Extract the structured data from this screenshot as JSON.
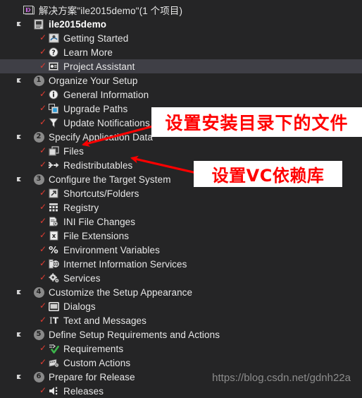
{
  "window": {
    "background_color": "#252526",
    "selection_color": "#3f3f46",
    "text_color": "#e8e8e8",
    "check_color": "#e03c31"
  },
  "solution": {
    "icon": "visual-studio-solution-icon",
    "label": "解决方案\"ile2015demo\"(1 个项目)"
  },
  "project": {
    "icon": "installshield-project-icon",
    "label": "ile2015demo"
  },
  "tree": {
    "items": [
      {
        "label": "Getting Started",
        "icon": "getting-started-icon",
        "level": 2,
        "check": true,
        "selected": false,
        "expander": false,
        "number": ""
      },
      {
        "label": "Learn More",
        "icon": "question-mark-icon",
        "level": 2,
        "check": true,
        "selected": false,
        "expander": false,
        "number": ""
      },
      {
        "label": "Project Assistant",
        "icon": "project-assistant-icon",
        "level": 2,
        "check": true,
        "selected": true,
        "expander": false,
        "number": ""
      },
      {
        "label": "Organize Your Setup",
        "icon": "number-circle-icon",
        "level": 1,
        "check": false,
        "selected": false,
        "expander": true,
        "number": "1"
      },
      {
        "label": "General Information",
        "icon": "information-icon",
        "level": 2,
        "check": true,
        "selected": false,
        "expander": false,
        "number": ""
      },
      {
        "label": "Upgrade Paths",
        "icon": "upgrade-paths-icon",
        "level": 2,
        "check": true,
        "selected": false,
        "expander": false,
        "number": ""
      },
      {
        "label": "Update Notifications",
        "icon": "funnel-icon",
        "level": 2,
        "check": true,
        "selected": false,
        "expander": false,
        "number": ""
      },
      {
        "label": "Specify Application Data",
        "icon": "number-circle-icon",
        "level": 1,
        "check": false,
        "selected": false,
        "expander": true,
        "number": "2"
      },
      {
        "label": "Files",
        "icon": "files-icon",
        "level": 2,
        "check": true,
        "selected": false,
        "expander": false,
        "number": ""
      },
      {
        "label": "Redistributables",
        "icon": "redistributables-icon",
        "level": 2,
        "check": true,
        "selected": false,
        "expander": false,
        "number": ""
      },
      {
        "label": "Configure the Target System",
        "icon": "number-circle-icon",
        "level": 1,
        "check": false,
        "selected": false,
        "expander": true,
        "number": "3"
      },
      {
        "label": "Shortcuts/Folders",
        "icon": "shortcuts-folders-icon",
        "level": 2,
        "check": true,
        "selected": false,
        "expander": false,
        "number": ""
      },
      {
        "label": "Registry",
        "icon": "registry-icon",
        "level": 2,
        "check": true,
        "selected": false,
        "expander": false,
        "number": ""
      },
      {
        "label": "INI File Changes",
        "icon": "ini-file-icon",
        "level": 2,
        "check": true,
        "selected": false,
        "expander": false,
        "number": ""
      },
      {
        "label": "File Extensions",
        "icon": "file-extensions-icon",
        "level": 2,
        "check": true,
        "selected": false,
        "expander": false,
        "number": ""
      },
      {
        "label": "Environment Variables",
        "icon": "percent-icon",
        "level": 2,
        "check": true,
        "selected": false,
        "expander": false,
        "number": ""
      },
      {
        "label": "Internet Information Services",
        "icon": "iis-globe-icon",
        "level": 2,
        "check": true,
        "selected": false,
        "expander": false,
        "number": ""
      },
      {
        "label": "Services",
        "icon": "services-gear-icon",
        "level": 2,
        "check": true,
        "selected": false,
        "expander": false,
        "number": ""
      },
      {
        "label": "Customize the Setup Appearance",
        "icon": "number-circle-icon",
        "level": 1,
        "check": false,
        "selected": false,
        "expander": true,
        "number": "4"
      },
      {
        "label": "Dialogs",
        "icon": "dialogs-window-icon",
        "level": 2,
        "check": true,
        "selected": false,
        "expander": false,
        "number": ""
      },
      {
        "label": "Text and Messages",
        "icon": "text-messages-icon",
        "level": 2,
        "check": true,
        "selected": false,
        "expander": false,
        "number": ""
      },
      {
        "label": "Define Setup Requirements and Actions",
        "icon": "number-circle-icon",
        "level": 1,
        "check": false,
        "selected": false,
        "expander": true,
        "number": "5"
      },
      {
        "label": "Requirements",
        "icon": "requirements-check-icon",
        "level": 2,
        "check": true,
        "selected": false,
        "expander": false,
        "number": ""
      },
      {
        "label": "Custom Actions",
        "icon": "custom-actions-icon",
        "level": 2,
        "check": true,
        "selected": false,
        "expander": false,
        "number": ""
      },
      {
        "label": "Prepare for Release",
        "icon": "number-circle-icon",
        "level": 1,
        "check": false,
        "selected": false,
        "expander": true,
        "number": "6"
      },
      {
        "label": "Releases",
        "icon": "releases-icon",
        "level": 2,
        "check": true,
        "selected": false,
        "expander": false,
        "number": ""
      }
    ]
  },
  "annotations": [
    {
      "text": "设置安装目录下的文件",
      "color": "#ff0000",
      "background": "#ffffff",
      "points_to": "Files"
    },
    {
      "text": "设置VC依赖库",
      "color": "#ff0000",
      "background": "#ffffff",
      "points_to": "Redistributables"
    }
  ],
  "watermark": {
    "text": "https://blog.csdn.net/gdnh22a"
  }
}
